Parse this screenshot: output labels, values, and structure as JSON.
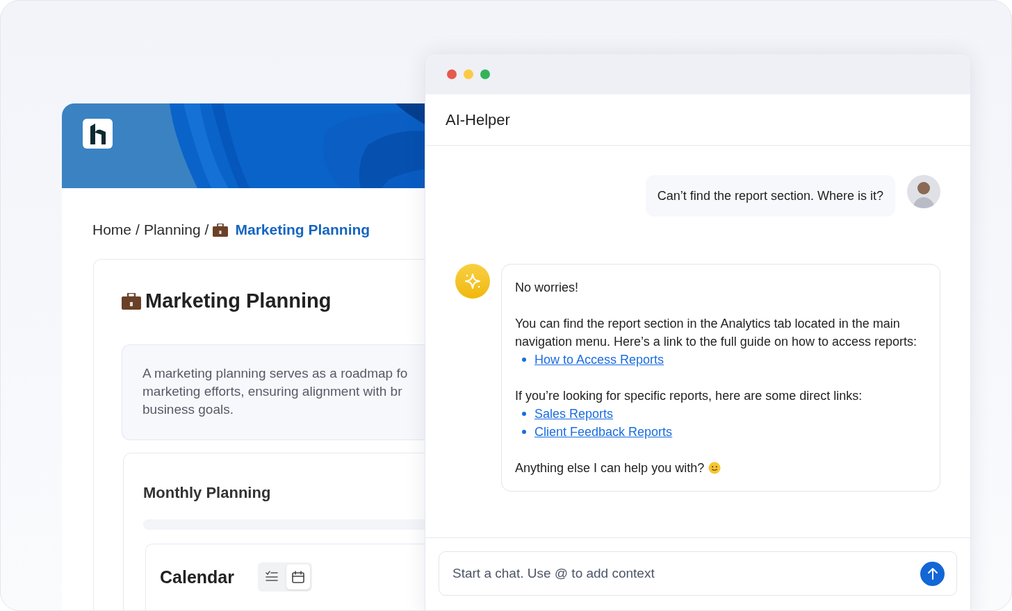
{
  "back_window": {
    "breadcrumb": {
      "items": [
        {
          "label": "Home",
          "selected": false
        },
        {
          "label": "Planning",
          "selected": false
        },
        {
          "label": "Marketing Planning",
          "selected": true
        }
      ],
      "separators": [
        "/",
        "/"
      ]
    },
    "page_title": "Marketing Planning",
    "description": {
      "lines": [
        "A marketing planning serves as a roadmap fo",
        "marketing efforts, ensuring alignment with br",
        "business goals."
      ]
    },
    "section": {
      "title": "Monthly Planning",
      "calendar": {
        "title": "Calendar",
        "views": [
          {
            "kind": "list",
            "selected": false
          },
          {
            "kind": "calendar",
            "selected": true
          }
        ]
      }
    }
  },
  "chat": {
    "title": "AI-Helper",
    "messages": [
      {
        "kind": "user",
        "text": "Can’t find the report section. Where is it?"
      },
      {
        "kind": "bot",
        "blocks": [
          {
            "kind": "paragraph",
            "text": "No worries!"
          },
          {
            "kind": "paragraph",
            "text": "You can find the report section in the Analytics tab located in the main navigation menu. Here’s a link to the full guide on how to access reports:"
          },
          {
            "kind": "links",
            "items": [
              "How to Access Reports"
            ]
          },
          {
            "kind": "paragraph",
            "text": "If you’re looking for specific reports, here are some direct links:"
          },
          {
            "kind": "links",
            "items": [
              "Sales Reports",
              "Client Feedback Reports"
            ]
          },
          {
            "kind": "closing",
            "text": "Anything else I can help you with?"
          }
        ]
      }
    ],
    "input": {
      "placeholder": "Start a chat. Use @ to add context"
    }
  }
}
